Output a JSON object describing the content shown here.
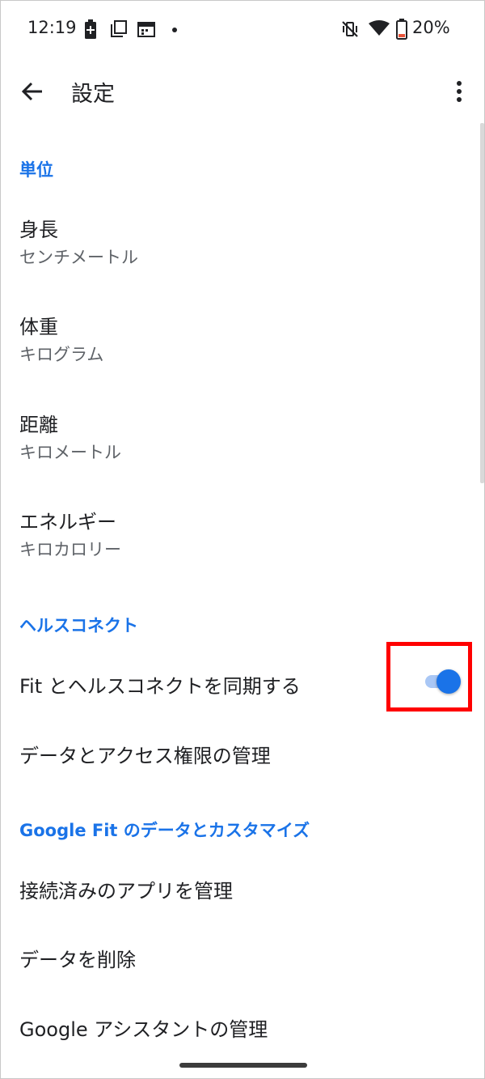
{
  "status_bar": {
    "time": "12:19",
    "battery_percent": "20%",
    "icons": [
      "battery-saver-icon",
      "copy-icon",
      "calendar-icon",
      "dot-icon",
      "vibrate-off-icon",
      "wifi-icon",
      "battery-low-icon"
    ]
  },
  "app_bar": {
    "title": "設定"
  },
  "sections": {
    "units": {
      "header": "単位",
      "height": {
        "title": "身長",
        "value": "センチメートル"
      },
      "weight": {
        "title": "体重",
        "value": "キログラム"
      },
      "distance": {
        "title": "距離",
        "value": "キロメートル"
      },
      "energy": {
        "title": "エネルギー",
        "value": "キロカロリー"
      }
    },
    "health_connect": {
      "header": "ヘルスコネクト",
      "sync": {
        "label": "Fit とヘルスコネクトを同期する",
        "enabled": true
      },
      "manage_data": "データとアクセス権限の管理"
    },
    "google_fit": {
      "header": "Google Fit のデータとカスタマイズ",
      "connected_apps": "接続済みのアプリを管理",
      "delete_data": "データを削除",
      "assistant": "Google アシスタントの管理"
    }
  },
  "colors": {
    "accent": "#1a73e8",
    "highlight": "#ff0000"
  }
}
